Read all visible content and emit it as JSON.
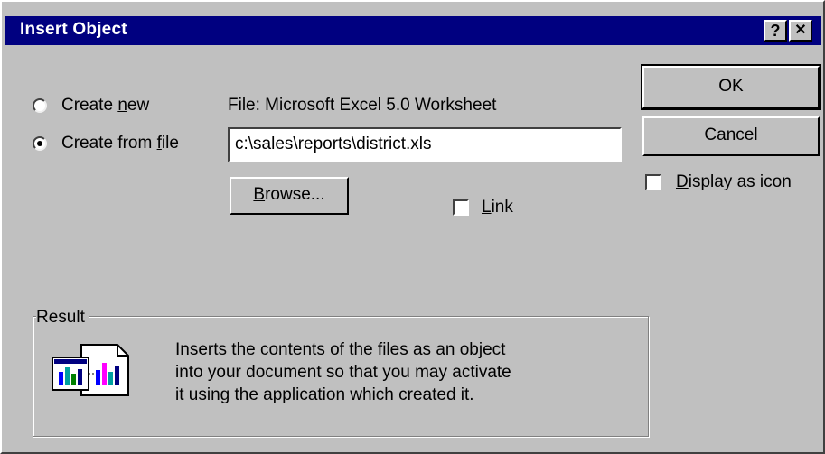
{
  "window": {
    "title": "Insert Object",
    "help_glyph": "?",
    "close_glyph": "✕"
  },
  "options": {
    "create_new": {
      "prefix": "Create ",
      "accel": "n",
      "suffix": "ew",
      "selected": false
    },
    "create_from_file": {
      "prefix": "Create from ",
      "accel": "f",
      "suffix": "ile",
      "selected": true
    }
  },
  "file": {
    "type_label": "File: Microsoft Excel 5.0 Worksheet",
    "path_value": "c:\\sales\\reports\\district.xls"
  },
  "buttons": {
    "browse": {
      "accel": "B",
      "rest": "rowse..."
    },
    "ok": "OK",
    "cancel": "Cancel"
  },
  "link": {
    "accel": "L",
    "rest": "ink",
    "checked": false
  },
  "display_as_icon": {
    "accel": "D",
    "rest": "isplay as icon",
    "checked": false
  },
  "result": {
    "label": "Result",
    "line1": "Inserts the contents of the files as an object",
    "line2": "into your document so that you may activate",
    "line3": "it using the application which created it.",
    "icon": "linked-documents-chart-icon"
  },
  "colors": {
    "titlebar": "#000080",
    "dialog_face": "#c0c0c0"
  }
}
